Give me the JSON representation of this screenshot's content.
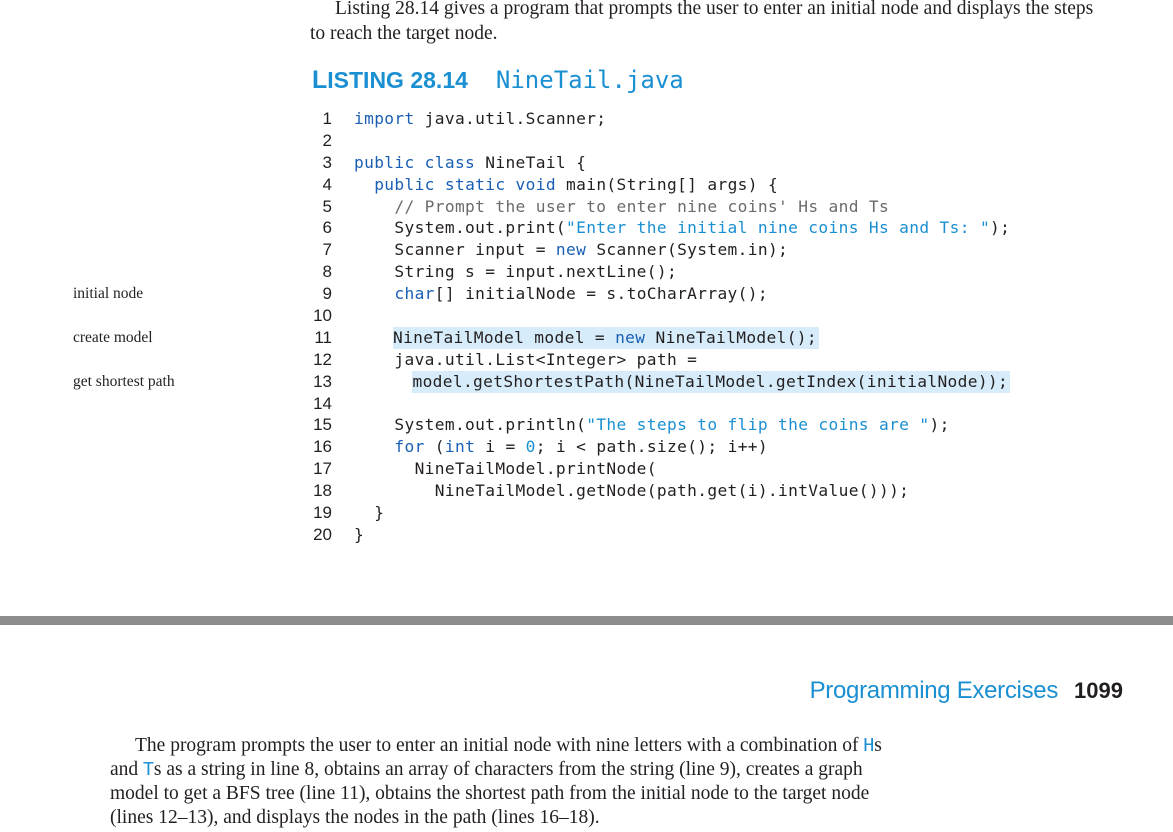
{
  "intro": {
    "text": "Listing 28.14 gives a program that prompts the user to enter an initial node and displays the steps to reach the target node."
  },
  "listing": {
    "label_cap": "L",
    "label_rest": "ISTING 28.14",
    "title": "NineTail.java",
    "lines": [
      {
        "n": "1",
        "hl": false,
        "parts": [
          {
            "t": "import",
            "c": "kw"
          },
          {
            "t": " java.util.Scanner;",
            "c": ""
          }
        ]
      },
      {
        "n": "2",
        "hl": false,
        "parts": []
      },
      {
        "n": "3",
        "hl": false,
        "parts": [
          {
            "t": "public class",
            "c": "kw"
          },
          {
            "t": " NineTail {",
            "c": ""
          }
        ]
      },
      {
        "n": "4",
        "hl": false,
        "parts": [
          {
            "t": "  ",
            "c": ""
          },
          {
            "t": "public static void",
            "c": "kw"
          },
          {
            "t": " main(String[] args) {",
            "c": ""
          }
        ]
      },
      {
        "n": "5",
        "hl": false,
        "parts": [
          {
            "t": "    ",
            "c": ""
          },
          {
            "t": "// Prompt the user to enter nine coins' Hs and Ts",
            "c": "cm"
          }
        ]
      },
      {
        "n": "6",
        "hl": false,
        "parts": [
          {
            "t": "    System.out.print(",
            "c": ""
          },
          {
            "t": "\"Enter the initial nine coins Hs and Ts: \"",
            "c": "str"
          },
          {
            "t": ");",
            "c": ""
          }
        ]
      },
      {
        "n": "7",
        "hl": false,
        "parts": [
          {
            "t": "    Scanner input = ",
            "c": ""
          },
          {
            "t": "new",
            "c": "kw"
          },
          {
            "t": " Scanner(System.in);",
            "c": ""
          }
        ]
      },
      {
        "n": "8",
        "hl": false,
        "parts": [
          {
            "t": "    String s = input.nextLine();",
            "c": ""
          }
        ]
      },
      {
        "n": "9",
        "hl": false,
        "parts": [
          {
            "t": "    ",
            "c": ""
          },
          {
            "t": "char",
            "c": "kw"
          },
          {
            "t": "[] initialNode = s.toCharArray();",
            "c": ""
          }
        ]
      },
      {
        "n": "10",
        "hl": false,
        "parts": []
      },
      {
        "n": "11",
        "hl": true,
        "indent": "    ",
        "parts": [
          {
            "t": "NineTailModel model = ",
            "c": ""
          },
          {
            "t": "new",
            "c": "kw"
          },
          {
            "t": " NineTailModel();",
            "c": ""
          }
        ]
      },
      {
        "n": "12",
        "hl": false,
        "parts": [
          {
            "t": "    java.util.List<Integer> path =",
            "c": ""
          }
        ]
      },
      {
        "n": "13",
        "hl": true,
        "indent": "      ",
        "parts": [
          {
            "t": "model.getShortestPath(NineTailModel.getIndex(initialNode));",
            "c": ""
          }
        ]
      },
      {
        "n": "14",
        "hl": false,
        "parts": []
      },
      {
        "n": "15",
        "hl": false,
        "parts": [
          {
            "t": "    System.out.println(",
            "c": ""
          },
          {
            "t": "\"The steps to flip the coins are \"",
            "c": "str"
          },
          {
            "t": ");",
            "c": ""
          }
        ]
      },
      {
        "n": "16",
        "hl": false,
        "parts": [
          {
            "t": "    ",
            "c": ""
          },
          {
            "t": "for",
            "c": "kw"
          },
          {
            "t": " (",
            "c": ""
          },
          {
            "t": "int",
            "c": "kw"
          },
          {
            "t": " i = ",
            "c": ""
          },
          {
            "t": "0",
            "c": "num"
          },
          {
            "t": "; i < path.size(); i++)",
            "c": ""
          }
        ]
      },
      {
        "n": "17",
        "hl": false,
        "parts": [
          {
            "t": "      NineTailModel.printNode(",
            "c": ""
          }
        ]
      },
      {
        "n": "18",
        "hl": false,
        "parts": [
          {
            "t": "        NineTailModel.getNode(path.get(i).intValue()));",
            "c": ""
          }
        ]
      },
      {
        "n": "19",
        "hl": false,
        "parts": [
          {
            "t": "  }",
            "c": ""
          }
        ]
      },
      {
        "n": "20",
        "hl": false,
        "parts": [
          {
            "t": "}",
            "c": ""
          }
        ]
      }
    ]
  },
  "margin_notes": [
    {
      "text": "initial node",
      "line": 9
    },
    {
      "text": "create model",
      "line": 11
    },
    {
      "text": "get shortest path",
      "line": 13
    }
  ],
  "running_head": {
    "title": "Programming Exercises",
    "page": "1099"
  },
  "body": {
    "p1": "The program prompts the user to enter an initial node with nine letters with a combination of ",
    "h": "H",
    "p2": "s and ",
    "t": "T",
    "p3": "s as a string in line 8, obtains an array of characters from the string (line 9), creates a graph model to get a BFS tree (line 11), obtains the shortest path from the initial node to the target node (lines 12–13), and displays the nodes in the path (lines 16–18)."
  }
}
